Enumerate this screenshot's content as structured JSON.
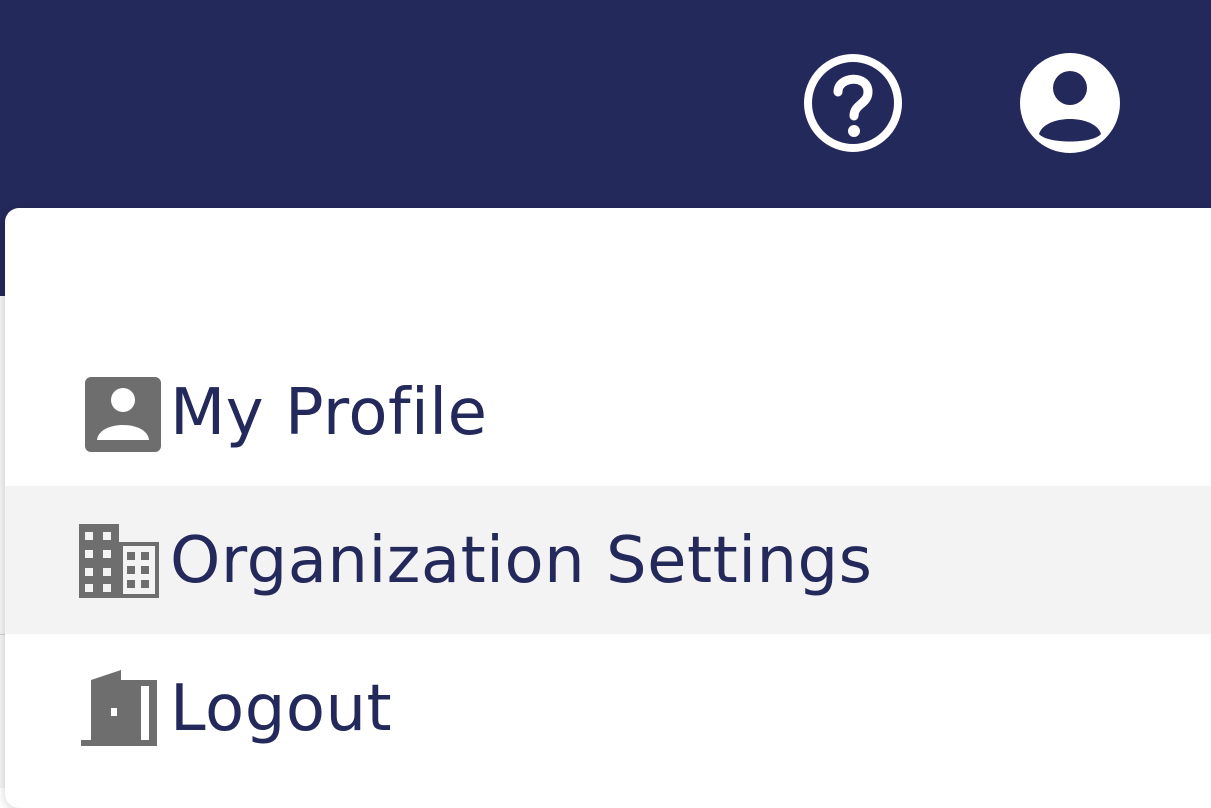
{
  "header": {
    "help_icon": "help-circle-icon",
    "account_icon": "account-circle-icon"
  },
  "user_menu": {
    "items": [
      {
        "label": "My Profile",
        "icon": "profile-card-icon"
      },
      {
        "label": "Organization Settings",
        "icon": "building-icon",
        "highlighted": true
      },
      {
        "label": "Logout",
        "icon": "door-exit-icon"
      }
    ]
  },
  "colors": {
    "header_bg": "#24295b",
    "text": "#24295b",
    "icon_gray": "#6e6e6e",
    "hover_bg": "#f3f3f3"
  }
}
